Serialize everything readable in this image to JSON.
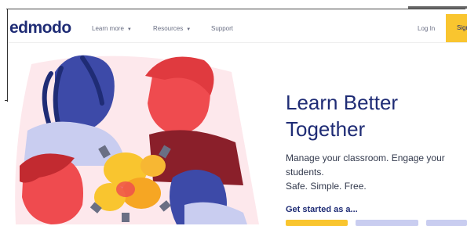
{
  "header": {
    "logo": "edmodo",
    "nav": {
      "learn_more": "Learn more",
      "resources": "Resources",
      "support": "Support"
    },
    "login": "Log In",
    "signup": "Sign"
  },
  "hero": {
    "title_line1": "Learn Better",
    "title_line2": "Together",
    "desc_line1": "Manage your classroom. Engage your",
    "desc_line2": "students.",
    "desc_line3": "Safe. Simple. Free.",
    "cta_label": "Get started as a..."
  },
  "colors": {
    "brand_navy": "#1f2c75",
    "accent_yellow": "#f9c52f",
    "lavender": "#c9cdf0",
    "illustration_red": "#ef4b4f",
    "illustration_blue": "#3d4aa8",
    "illustration_pink": "#fde8ec"
  },
  "icons": {
    "caret": "caret-down-icon"
  }
}
